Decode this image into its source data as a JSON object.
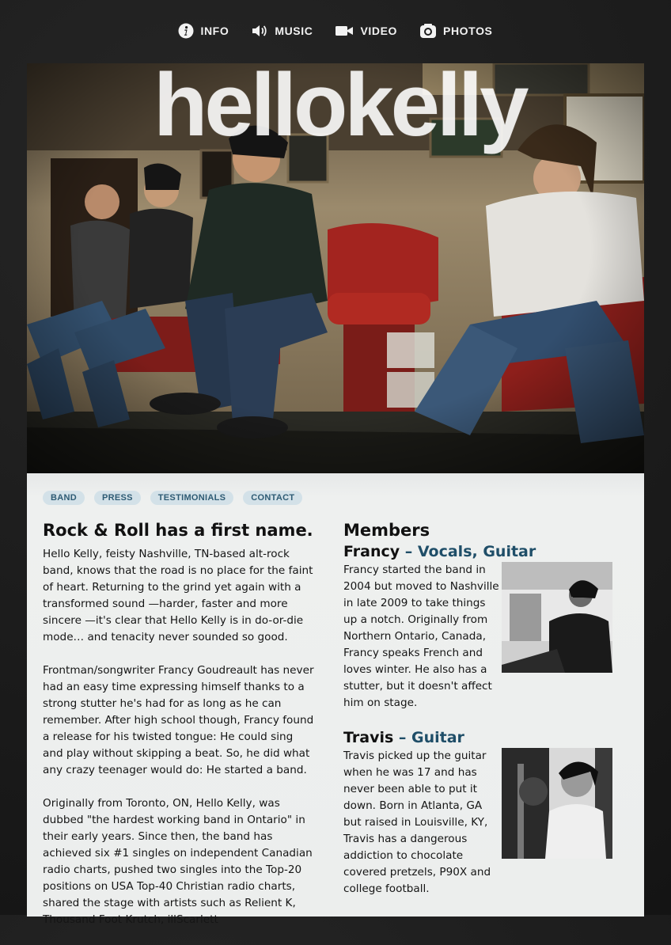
{
  "topnav": [
    {
      "label": "INFO",
      "icon": "info-icon"
    },
    {
      "label": "MUSIC",
      "icon": "speaker-icon"
    },
    {
      "label": "VIDEO",
      "icon": "video-camera-icon"
    },
    {
      "label": "PHOTOS",
      "icon": "camera-icon"
    }
  ],
  "hero": {
    "brand": "hellokelly"
  },
  "subnav": [
    "BAND",
    "PRESS",
    "TESTIMONIALS",
    "CONTACT"
  ],
  "bio": {
    "title": "Rock & Roll has a first name.",
    "paragraphs": [
      "Hello Kelly, feisty Nashville, TN-based alt-rock band, knows that the road is no place for the faint of heart. Returning to the grind yet again with a transformed sound —harder, faster and more sincere —it's clear that Hello Kelly is in do-or-die mode… and tenacity never sounded so good.",
      "Frontman/songwriter Francy Goudreault has never had an easy time expressing himself thanks to a strong stutter he's had for as long as he can remember. After high school though, Francy found a release for his twisted tongue: He could sing and play without skipping a beat. So, he did what any crazy teenager would do: He started a band.",
      "Originally from Toronto, ON, Hello Kelly, was dubbed \"the hardest working band in Ontario\" in their early years. Since then, the band has achieved six #1 singles on independent Canadian radio charts, pushed two singles into the Top-20 positions on USA Top-40 Christian radio charts, shared the stage with artists such as Relient K, Thousand Foot Krutch, illScarlett"
    ]
  },
  "members": {
    "title": "Members",
    "list": [
      {
        "name": "Francy",
        "role": "– Vocals, Guitar",
        "bio": "Francy started the band in 2004 but moved to Nashville in late 2009 to take things up a notch. Originally from Northern Ontario, Canada, Francy speaks French and loves winter. He also has a stutter, but it doesn't affect him on stage."
      },
      {
        "name": "Travis",
        "role": "– Guitar",
        "bio": "Travis picked up the guitar when he was 17 and has never been able to put it down. Born in Atlanta, GA but raised in Louisville, KY, Travis has a dangerous addiction to chocolate covered pretzels, P90X and college football."
      }
    ]
  },
  "colors": {
    "accent": "#1f4e68",
    "pill_bg": "#d3e1e8",
    "pill_text": "#2e5b74",
    "page_bg": "#1c1c1c",
    "content_bg": "#eceeed"
  }
}
